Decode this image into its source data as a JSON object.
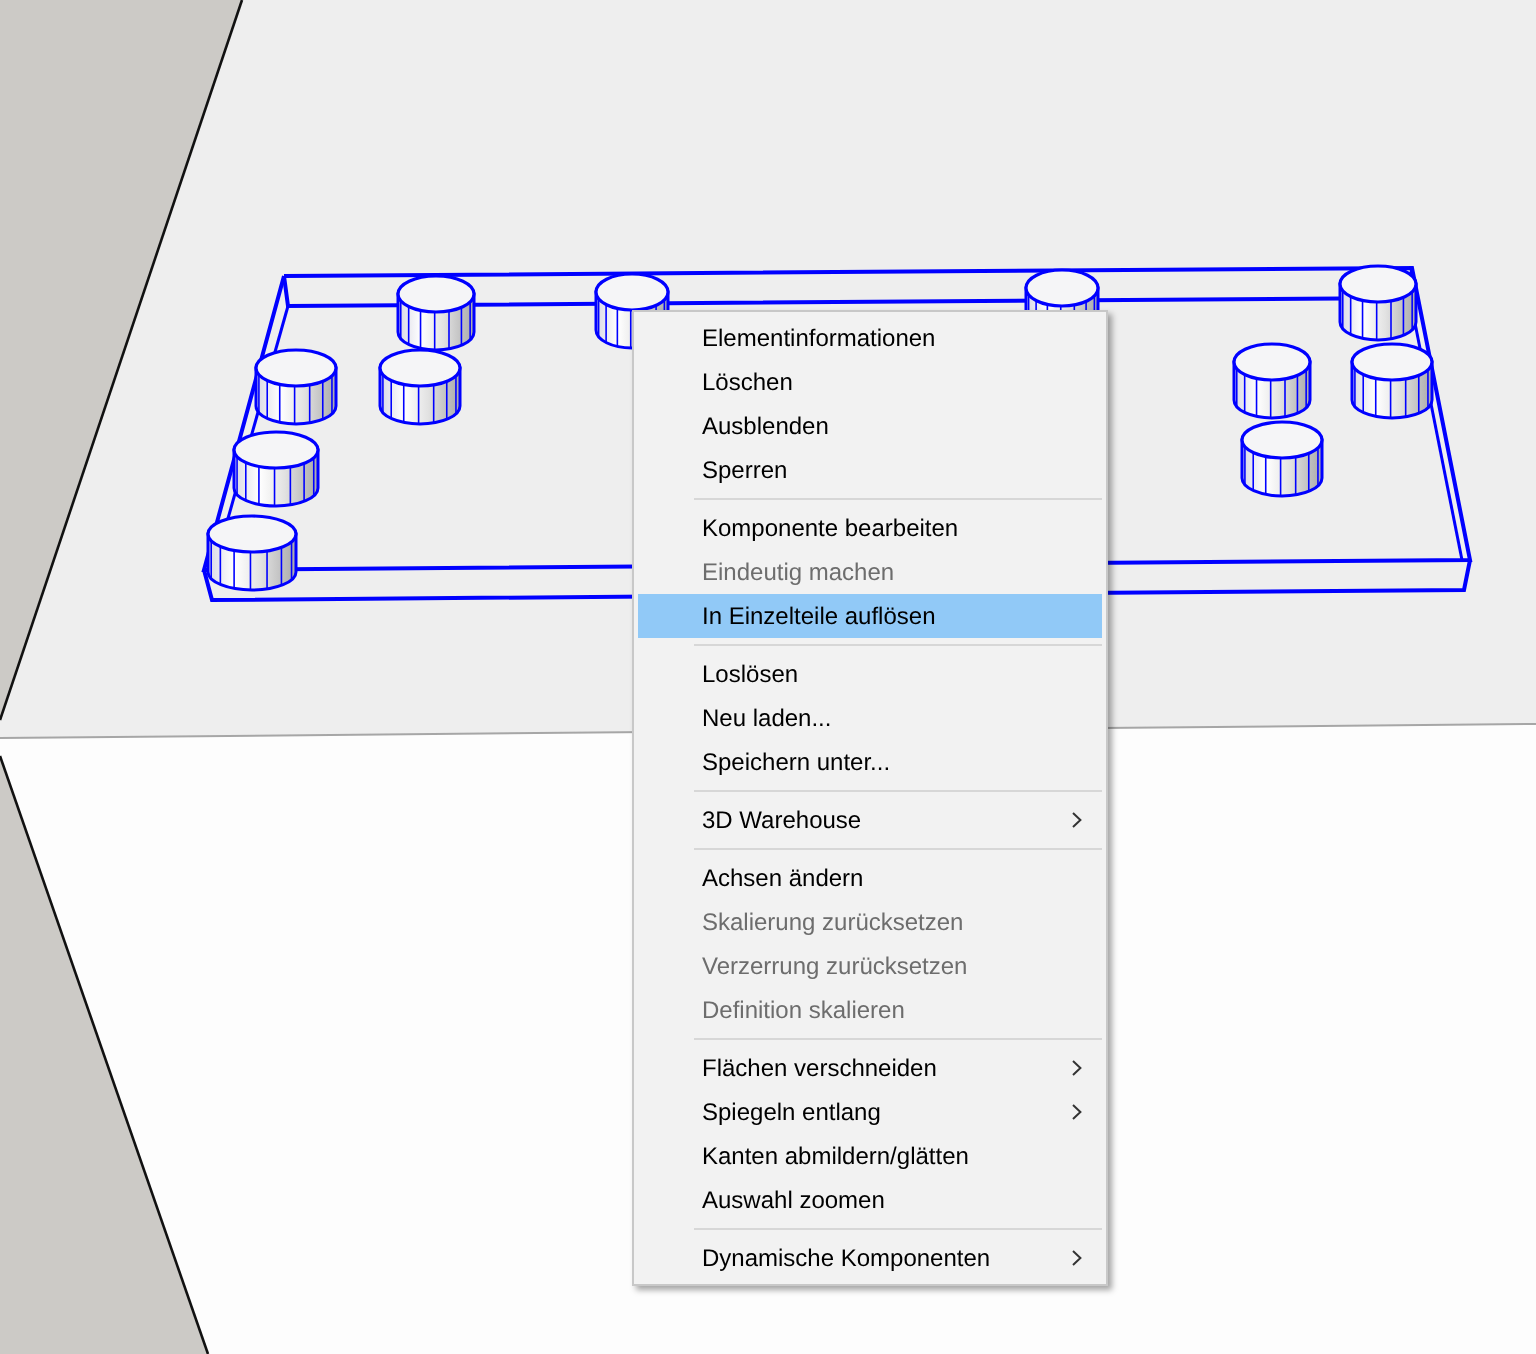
{
  "model": {
    "selected": true
  },
  "context_menu": {
    "groups": [
      {
        "items": [
          {
            "label": "Elementinformationen",
            "disabled": false,
            "selected": false,
            "submenu": false
          },
          {
            "label": "Löschen",
            "disabled": false,
            "selected": false,
            "submenu": false
          },
          {
            "label": "Ausblenden",
            "disabled": false,
            "selected": false,
            "submenu": false
          },
          {
            "label": "Sperren",
            "disabled": false,
            "selected": false,
            "submenu": false
          }
        ]
      },
      {
        "items": [
          {
            "label": "Komponente bearbeiten",
            "disabled": false,
            "selected": false,
            "submenu": false
          },
          {
            "label": "Eindeutig machen",
            "disabled": true,
            "selected": false,
            "submenu": false
          },
          {
            "label": "In Einzelteile auflösen",
            "disabled": false,
            "selected": true,
            "submenu": false
          }
        ]
      },
      {
        "items": [
          {
            "label": "Loslösen",
            "disabled": false,
            "selected": false,
            "submenu": false
          },
          {
            "label": "Neu laden...",
            "disabled": false,
            "selected": false,
            "submenu": false
          },
          {
            "label": "Speichern unter...",
            "disabled": false,
            "selected": false,
            "submenu": false
          }
        ]
      },
      {
        "items": [
          {
            "label": "3D Warehouse",
            "disabled": false,
            "selected": false,
            "submenu": true
          }
        ]
      },
      {
        "items": [
          {
            "label": "Achsen ändern",
            "disabled": false,
            "selected": false,
            "submenu": false
          },
          {
            "label": "Skalierung zurücksetzen",
            "disabled": true,
            "selected": false,
            "submenu": false
          },
          {
            "label": "Verzerrung zurücksetzen",
            "disabled": true,
            "selected": false,
            "submenu": false
          },
          {
            "label": "Definition skalieren",
            "disabled": true,
            "selected": false,
            "submenu": false
          }
        ]
      },
      {
        "items": [
          {
            "label": "Flächen verschneiden",
            "disabled": false,
            "selected": false,
            "submenu": true
          },
          {
            "label": "Spiegeln entlang",
            "disabled": false,
            "selected": false,
            "submenu": true
          },
          {
            "label": "Kanten abmildern/glätten",
            "disabled": false,
            "selected": false,
            "submenu": false
          },
          {
            "label": "Auswahl zoomen",
            "disabled": false,
            "selected": false,
            "submenu": false
          }
        ]
      },
      {
        "items": [
          {
            "label": "Dynamische Komponenten",
            "disabled": false,
            "selected": false,
            "submenu": true
          }
        ]
      }
    ]
  }
}
